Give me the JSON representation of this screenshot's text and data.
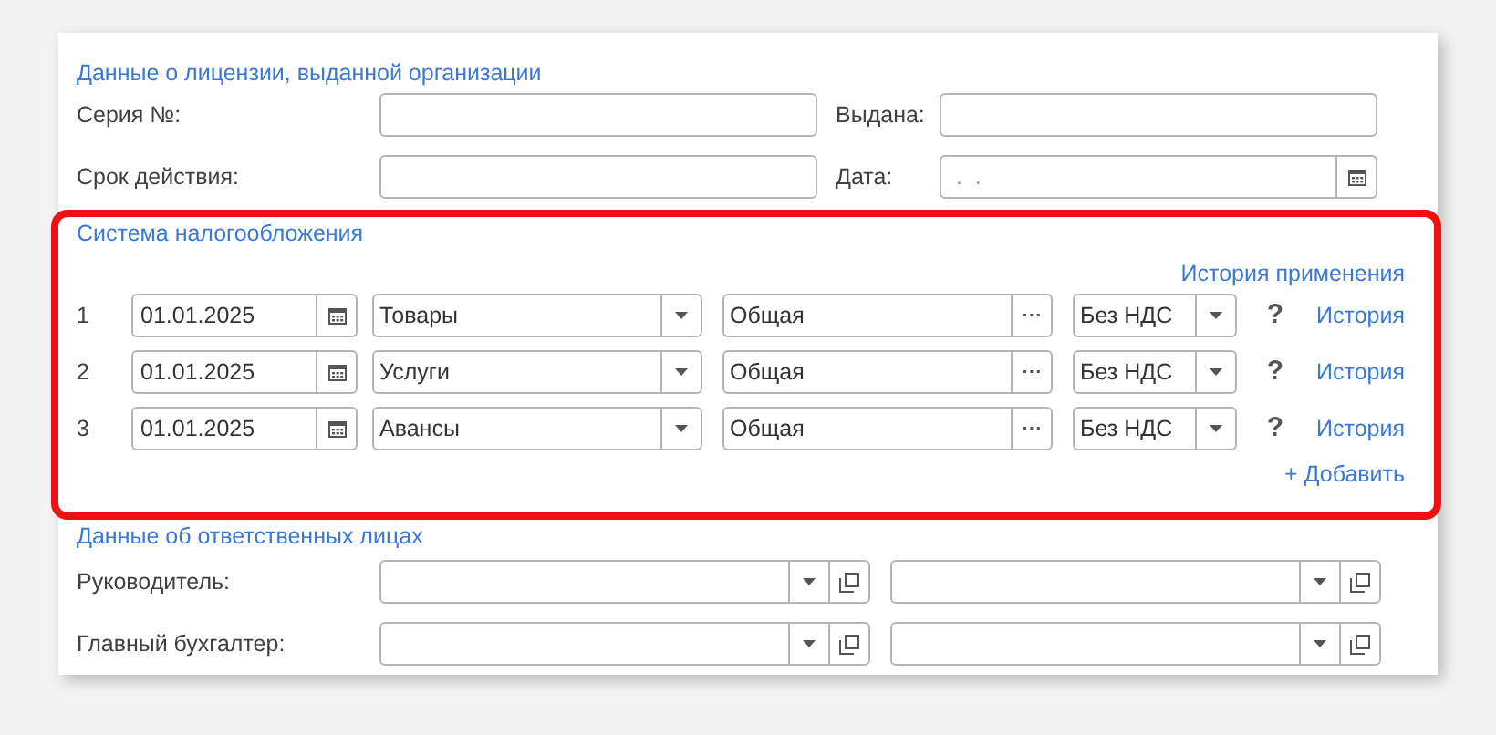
{
  "license": {
    "title": "Данные о лицензии, выданной организации",
    "rows": [
      {
        "label": "Серия №:",
        "label_2": "Выдана:",
        "kind": "text"
      },
      {
        "label": "Срок действия:",
        "label_2": "Дата:",
        "kind": "date",
        "placeholder_2": ".  ."
      }
    ]
  },
  "taxation": {
    "title": "Система налогообложения",
    "history_link": "История применения",
    "rows": [
      {
        "number": "1",
        "date": "01.01.2025",
        "kind": "Товары",
        "system": "Общая",
        "vat": "Без НДС",
        "help": "?",
        "link": "История"
      },
      {
        "number": "2",
        "date": "01.01.2025",
        "kind": "Услуги",
        "system": "Общая",
        "vat": "Без НДС",
        "help": "?",
        "link": "История"
      },
      {
        "number": "3",
        "date": "01.01.2025",
        "kind": "Авансы",
        "system": "Общая",
        "vat": "Без НДС",
        "help": "?",
        "link": "История"
      }
    ],
    "add_link": "+ Добавить"
  },
  "responsible": {
    "title": "Данные об ответственных лицах",
    "rows": [
      {
        "label": "Руководитель:"
      },
      {
        "label": "Главный бухгалтер:"
      }
    ]
  }
}
